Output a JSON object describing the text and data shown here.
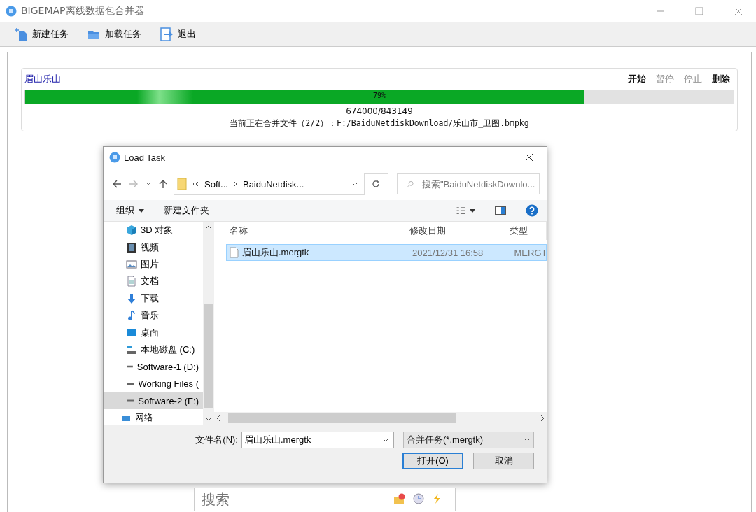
{
  "window": {
    "title": "BIGEMAP离线数据包合并器"
  },
  "toolbar": [
    {
      "label": "新建任务",
      "kind": "new"
    },
    {
      "label": "加载任务",
      "kind": "folder"
    },
    {
      "label": "退出",
      "kind": "exit"
    }
  ],
  "task": {
    "name": "眉山乐山",
    "actions": [
      {
        "label": "开始",
        "disabled": false
      },
      {
        "label": "暂停",
        "disabled": true
      },
      {
        "label": "停止",
        "disabled": true
      },
      {
        "label": "删除",
        "disabled": false
      }
    ],
    "progress": {
      "level": 0.79,
      "text": "79%"
    },
    "count": "674000/843149",
    "status": "当前正在合并文件（2/2）：F:/BaiduNetdiskDownload/乐山市_卫图.bmpkg"
  },
  "dialog": {
    "title": "Load Task",
    "breadcrumb": [
      "Soft...",
      "BaiduNetdisk..."
    ],
    "search": {
      "placeholder": "搜索\"BaiduNetdiskDownlo..."
    },
    "commands": [
      {
        "label": "组织",
        "kind": "menu"
      },
      {
        "label": "新建文件夹",
        "kind": "plain"
      }
    ],
    "nav": [
      {
        "label": "3D 对象",
        "kind": "cube",
        "selected": false
      },
      {
        "label": "视频",
        "kind": "video",
        "selected": false
      },
      {
        "label": "图片",
        "kind": "picture",
        "selected": false
      },
      {
        "label": "文档",
        "kind": "doc",
        "selected": false
      },
      {
        "label": "下载",
        "kind": "download",
        "selected": false
      },
      {
        "label": "音乐",
        "kind": "music",
        "selected": false
      },
      {
        "label": "桌面",
        "kind": "desktop",
        "selected": false
      },
      {
        "label": "本地磁盘 (C:)",
        "kind": "sysdrive",
        "selected": false
      },
      {
        "label": "Software-1 (D:)",
        "kind": "drive",
        "selected": false
      },
      {
        "label": "Working Files (",
        "kind": "drive",
        "selected": false
      },
      {
        "label": "Software-2 (F:)",
        "kind": "drive",
        "selected": true
      },
      {
        "label": "网络",
        "kind": "network",
        "selected": false
      }
    ],
    "columns": [
      "名称",
      "修改日期",
      "类型"
    ],
    "files": [
      {
        "name": "眉山乐山.mergtk",
        "date": "2021/12/31 16:58",
        "type": "MERGT",
        "selected": true
      }
    ],
    "filename_label": "文件名(N):",
    "filename": "眉山乐山.mergtk",
    "filter": "合并任务(*.mergtk)",
    "buttons": [
      {
        "label": "打开(O)",
        "kind": "primary"
      },
      {
        "label": "取消",
        "kind": "normal"
      }
    ]
  },
  "searchbar": {
    "placeholder": "搜索"
  }
}
